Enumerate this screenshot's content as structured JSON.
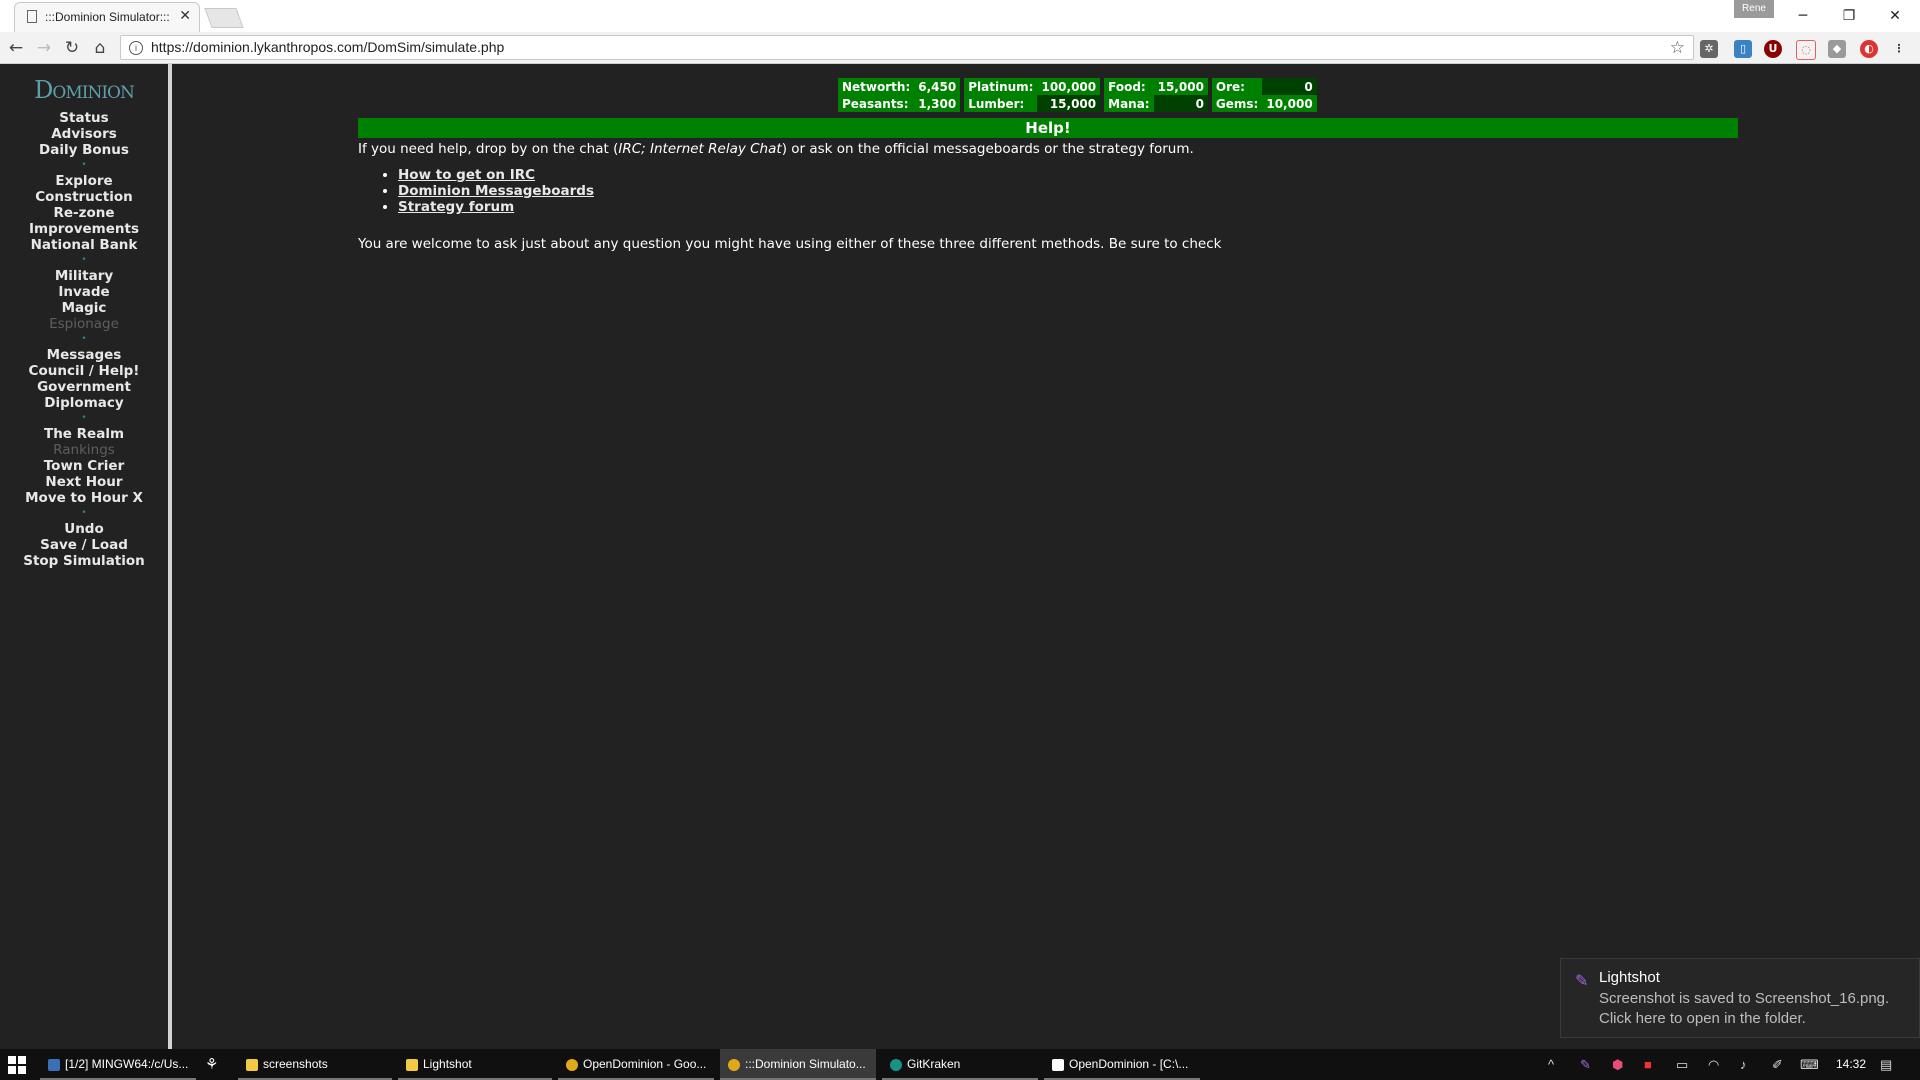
{
  "browser": {
    "tab_title": ":::Dominion Simulator:::",
    "tab_close": "✕",
    "profile": "Rene",
    "url": "https://dominion.lykanthropos.com/DomSim/simulate.php"
  },
  "sidebar": {
    "logo": "Dominion",
    "groups": [
      [
        "Status",
        "Advisors",
        "Daily Bonus"
      ],
      [
        "Explore",
        "Construction",
        "Re-zone",
        "Improvements",
        "National Bank"
      ],
      [
        "Military",
        "Invade",
        "Magic",
        "Espionage"
      ],
      [
        "Messages",
        "Council / Help!",
        "Government",
        "Diplomacy"
      ],
      [
        "The Realm",
        "Rankings",
        "Town Crier",
        "Next Hour",
        "Move to Hour X"
      ],
      [
        "Undo",
        "Save / Load",
        "Stop Simulation"
      ]
    ]
  },
  "stats": {
    "networth_label": "Networth:",
    "networth": "6,450",
    "platinum_label": "Platinum:",
    "platinum": "100,000",
    "food_label": "Food:",
    "food": "15,000",
    "ore_label": "Ore:",
    "ore": "0",
    "peasants_label": "Peasants:",
    "peasants": "1,300",
    "lumber_label": "Lumber:",
    "lumber": "15,000",
    "mana_label": "Mana:",
    "mana": "0",
    "gems_label": "Gems:",
    "gems": "10,000"
  },
  "help": {
    "heading": "Help!",
    "intro_before": "If you need help, drop by on the chat (",
    "intro_italic": "IRC; Internet Relay Chat",
    "intro_after": ") or ask on the official messageboards or the strategy forum.",
    "links": [
      "How to get on IRC",
      "Dominion Messageboards",
      "Strategy forum"
    ],
    "outro": "You are welcome to ask just about any question you might have using either of these three different methods. Be sure to check"
  },
  "toast": {
    "title": "Lightshot",
    "line1": "Screenshot is saved to Screenshot_16.png.",
    "line2": "Click here to open in the folder."
  },
  "taskbar": {
    "items": [
      "[1/2] MINGW64:/c/Us...",
      "screenshots",
      "Lightshot",
      "OpenDominion - Goo...",
      ":::Dominion Simulato...",
      "GitKraken",
      "OpenDominion - [C:\\..."
    ],
    "clock": "14:32"
  },
  "colors": {
    "page_bg": "#222222",
    "stat_label_bg": "#008000",
    "stat_value_bg": "#004000",
    "help_bar": "#008000",
    "logo": "#5e9fa8"
  }
}
